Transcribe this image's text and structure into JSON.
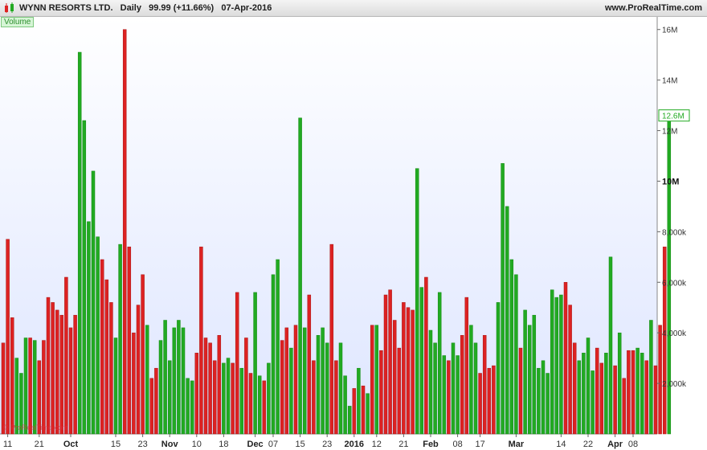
{
  "header": {
    "title": "WYNN RESORTS LTD.   Daily   99.99 (+11.66%)   07-Apr-2016",
    "url": "www.ProRealTime.com"
  },
  "indicator_label": "Volume",
  "last_value_label": "12.6M",
  "watermark": "© ProRealTime.com",
  "colors": {
    "up": "#22aa22",
    "down": "#dd2222",
    "bg_top": "#ffffff",
    "bg_bottom": "#dde5ff"
  },
  "chart_data": {
    "type": "bar",
    "ylim": [
      0,
      16500000
    ],
    "y_ticks": [
      {
        "value": 2000000,
        "label": "2,000k",
        "bold": false
      },
      {
        "value": 4000000,
        "label": "4,000k",
        "bold": false
      },
      {
        "value": 6000000,
        "label": "6,000k",
        "bold": false
      },
      {
        "value": 8000000,
        "label": "8,000k",
        "bold": false
      },
      {
        "value": 10000000,
        "label": "10M",
        "bold": true
      },
      {
        "value": 12000000,
        "label": "12M",
        "bold": false
      },
      {
        "value": 14000000,
        "label": "14M",
        "bold": false
      },
      {
        "value": 16000000,
        "label": "16M",
        "bold": false
      }
    ],
    "x_ticks": [
      {
        "index": 1,
        "label": "11",
        "bold": false
      },
      {
        "index": 8,
        "label": "21",
        "bold": false
      },
      {
        "index": 15,
        "label": "Oct",
        "bold": true
      },
      {
        "index": 25,
        "label": "15",
        "bold": false
      },
      {
        "index": 31,
        "label": "23",
        "bold": false
      },
      {
        "index": 37,
        "label": "Nov",
        "bold": true
      },
      {
        "index": 43,
        "label": "10",
        "bold": false
      },
      {
        "index": 49,
        "label": "18",
        "bold": false
      },
      {
        "index": 56,
        "label": "Dec",
        "bold": true
      },
      {
        "index": 60,
        "label": "07",
        "bold": false
      },
      {
        "index": 66,
        "label": "15",
        "bold": false
      },
      {
        "index": 72,
        "label": "23",
        "bold": false
      },
      {
        "index": 78,
        "label": "2016",
        "bold": true
      },
      {
        "index": 83,
        "label": "12",
        "bold": false
      },
      {
        "index": 89,
        "label": "21",
        "bold": false
      },
      {
        "index": 95,
        "label": "Feb",
        "bold": true
      },
      {
        "index": 101,
        "label": "08",
        "bold": false
      },
      {
        "index": 106,
        "label": "17",
        "bold": false
      },
      {
        "index": 114,
        "label": "Mar",
        "bold": true
      },
      {
        "index": 124,
        "label": "14",
        "bold": false
      },
      {
        "index": 130,
        "label": "22",
        "bold": false
      },
      {
        "index": 136,
        "label": "Apr",
        "bold": true
      },
      {
        "index": 140,
        "label": "08",
        "bold": false
      }
    ],
    "bars": [
      [
        3.6,
        "d"
      ],
      [
        7.7,
        "d"
      ],
      [
        4.6,
        "d"
      ],
      [
        3.0,
        "u"
      ],
      [
        2.4,
        "u"
      ],
      [
        3.8,
        "u"
      ],
      [
        3.8,
        "d"
      ],
      [
        3.7,
        "u"
      ],
      [
        2.9,
        "d"
      ],
      [
        3.7,
        "d"
      ],
      [
        5.4,
        "d"
      ],
      [
        5.2,
        "d"
      ],
      [
        4.9,
        "d"
      ],
      [
        4.7,
        "d"
      ],
      [
        6.2,
        "d"
      ],
      [
        4.2,
        "d"
      ],
      [
        4.7,
        "d"
      ],
      [
        15.1,
        "u"
      ],
      [
        12.4,
        "u"
      ],
      [
        8.4,
        "u"
      ],
      [
        10.4,
        "u"
      ],
      [
        7.8,
        "u"
      ],
      [
        6.9,
        "d"
      ],
      [
        6.1,
        "d"
      ],
      [
        5.2,
        "d"
      ],
      [
        3.8,
        "u"
      ],
      [
        7.5,
        "u"
      ],
      [
        16.0,
        "d"
      ],
      [
        7.4,
        "d"
      ],
      [
        4.0,
        "d"
      ],
      [
        5.1,
        "d"
      ],
      [
        6.3,
        "d"
      ],
      [
        4.3,
        "u"
      ],
      [
        2.2,
        "d"
      ],
      [
        2.6,
        "d"
      ],
      [
        3.7,
        "u"
      ],
      [
        4.5,
        "u"
      ],
      [
        2.9,
        "u"
      ],
      [
        4.2,
        "u"
      ],
      [
        4.5,
        "u"
      ],
      [
        4.2,
        "u"
      ],
      [
        2.2,
        "u"
      ],
      [
        2.1,
        "u"
      ],
      [
        3.2,
        "d"
      ],
      [
        7.4,
        "d"
      ],
      [
        3.8,
        "d"
      ],
      [
        3.6,
        "d"
      ],
      [
        2.9,
        "d"
      ],
      [
        3.9,
        "d"
      ],
      [
        2.8,
        "u"
      ],
      [
        3.0,
        "u"
      ],
      [
        2.8,
        "d"
      ],
      [
        5.6,
        "d"
      ],
      [
        2.6,
        "u"
      ],
      [
        3.8,
        "d"
      ],
      [
        2.4,
        "d"
      ],
      [
        5.6,
        "u"
      ],
      [
        2.3,
        "u"
      ],
      [
        2.1,
        "d"
      ],
      [
        2.8,
        "u"
      ],
      [
        6.3,
        "u"
      ],
      [
        6.9,
        "u"
      ],
      [
        3.7,
        "d"
      ],
      [
        4.2,
        "d"
      ],
      [
        3.4,
        "u"
      ],
      [
        4.3,
        "d"
      ],
      [
        12.5,
        "u"
      ],
      [
        4.2,
        "u"
      ],
      [
        5.5,
        "d"
      ],
      [
        2.9,
        "d"
      ],
      [
        3.9,
        "u"
      ],
      [
        4.2,
        "u"
      ],
      [
        3.6,
        "u"
      ],
      [
        7.5,
        "d"
      ],
      [
        2.9,
        "d"
      ],
      [
        3.6,
        "u"
      ],
      [
        2.3,
        "u"
      ],
      [
        1.1,
        "u"
      ],
      [
        1.8,
        "d"
      ],
      [
        2.6,
        "u"
      ],
      [
        1.9,
        "d"
      ],
      [
        1.6,
        "u"
      ],
      [
        4.3,
        "d"
      ],
      [
        4.3,
        "u"
      ],
      [
        3.3,
        "d"
      ],
      [
        5.5,
        "d"
      ],
      [
        5.7,
        "d"
      ],
      [
        4.5,
        "d"
      ],
      [
        3.4,
        "d"
      ],
      [
        5.2,
        "d"
      ],
      [
        5.0,
        "d"
      ],
      [
        4.9,
        "d"
      ],
      [
        10.5,
        "u"
      ],
      [
        5.8,
        "u"
      ],
      [
        6.2,
        "d"
      ],
      [
        4.1,
        "u"
      ],
      [
        3.6,
        "u"
      ],
      [
        5.6,
        "u"
      ],
      [
        3.1,
        "u"
      ],
      [
        2.9,
        "d"
      ],
      [
        3.6,
        "u"
      ],
      [
        3.1,
        "u"
      ],
      [
        3.9,
        "d"
      ],
      [
        5.4,
        "d"
      ],
      [
        4.3,
        "u"
      ],
      [
        3.6,
        "u"
      ],
      [
        2.4,
        "d"
      ],
      [
        3.9,
        "d"
      ],
      [
        2.6,
        "d"
      ],
      [
        2.7,
        "d"
      ],
      [
        5.2,
        "u"
      ],
      [
        10.7,
        "u"
      ],
      [
        9.0,
        "u"
      ],
      [
        6.9,
        "u"
      ],
      [
        6.3,
        "u"
      ],
      [
        3.4,
        "d"
      ],
      [
        4.9,
        "u"
      ],
      [
        4.3,
        "u"
      ],
      [
        4.7,
        "u"
      ],
      [
        2.6,
        "u"
      ],
      [
        2.9,
        "u"
      ],
      [
        2.4,
        "u"
      ],
      [
        5.7,
        "u"
      ],
      [
        5.4,
        "u"
      ],
      [
        5.5,
        "u"
      ],
      [
        6.0,
        "d"
      ],
      [
        5.1,
        "d"
      ],
      [
        3.6,
        "d"
      ],
      [
        2.9,
        "u"
      ],
      [
        3.2,
        "u"
      ],
      [
        3.8,
        "u"
      ],
      [
        2.5,
        "u"
      ],
      [
        3.4,
        "d"
      ],
      [
        2.8,
        "d"
      ],
      [
        3.2,
        "u"
      ],
      [
        7.0,
        "u"
      ],
      [
        2.7,
        "d"
      ],
      [
        4.0,
        "u"
      ],
      [
        2.2,
        "d"
      ],
      [
        3.3,
        "d"
      ],
      [
        3.3,
        "d"
      ],
      [
        3.4,
        "u"
      ],
      [
        3.2,
        "u"
      ],
      [
        2.9,
        "d"
      ],
      [
        4.5,
        "u"
      ],
      [
        2.7,
        "d"
      ],
      [
        4.3,
        "d"
      ],
      [
        7.4,
        "d"
      ],
      [
        12.6,
        "u"
      ]
    ]
  }
}
